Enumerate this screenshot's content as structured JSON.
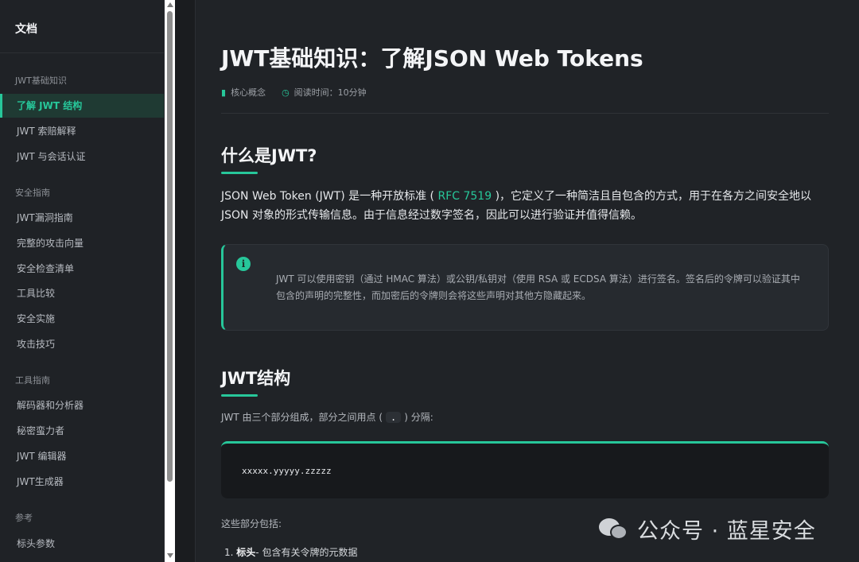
{
  "sidebar": {
    "header": "文档",
    "sections": [
      {
        "title": "JWT基础知识",
        "items": [
          "了解 JWT 结构",
          "JWT 索赔解释",
          "JWT 与会话认证"
        ]
      },
      {
        "title": "安全指南",
        "items": [
          "JWT漏洞指南",
          "完整的攻击向量",
          "安全检查清单",
          "工具比较",
          "安全实施",
          "攻击技巧"
        ]
      },
      {
        "title": "工具指南",
        "items": [
          "解码器和分析器",
          "秘密蛮力者",
          "JWT 编辑器",
          "JWT生成器"
        ]
      },
      {
        "title": "参考",
        "items": [
          "标头参数"
        ]
      }
    ],
    "active_item": "了解 JWT 结构"
  },
  "main": {
    "title": "JWT基础知识：了解JSON Web Tokens",
    "meta": {
      "category": "核心概念",
      "reading_time": "阅读时间：10分钟"
    },
    "section1": {
      "heading": "什么是JWT?",
      "para_before_link": "JSON Web Token (JWT) 是一种开放标准 (",
      "link": " RFC 7519 ",
      "para_after_link": ")，它定义了一种简洁且自包含的方式，用于在各方之间安全地以 JSON 对象的形式传输信息。由于信息经过数字签名，因此可以进行验证并值得信赖。",
      "callout": "JWT 可以使用密钥（通过 HMAC 算法）或公钥/私钥对（使用 RSA 或 ECDSA 算法）进行签名。签名后的令牌可以验证其中包含的声明的完整性，而加密后的令牌则会将这些声明对其他方隐藏起来。"
    },
    "section2": {
      "heading": "JWT结构",
      "intro_before": "JWT 由三个部分组成，部分之间用点 (",
      "intro_code": ".",
      "intro_after": ") 分隔:",
      "code": "xxxxx.yyyyy.zzzzz",
      "parts_intro": "这些部分包括:",
      "list": [
        {
          "num": "1.",
          "term": "标头",
          "desc": "- 包含有关令牌的元数据"
        }
      ]
    }
  },
  "watermark": "公众号 · 蓝星安全"
}
